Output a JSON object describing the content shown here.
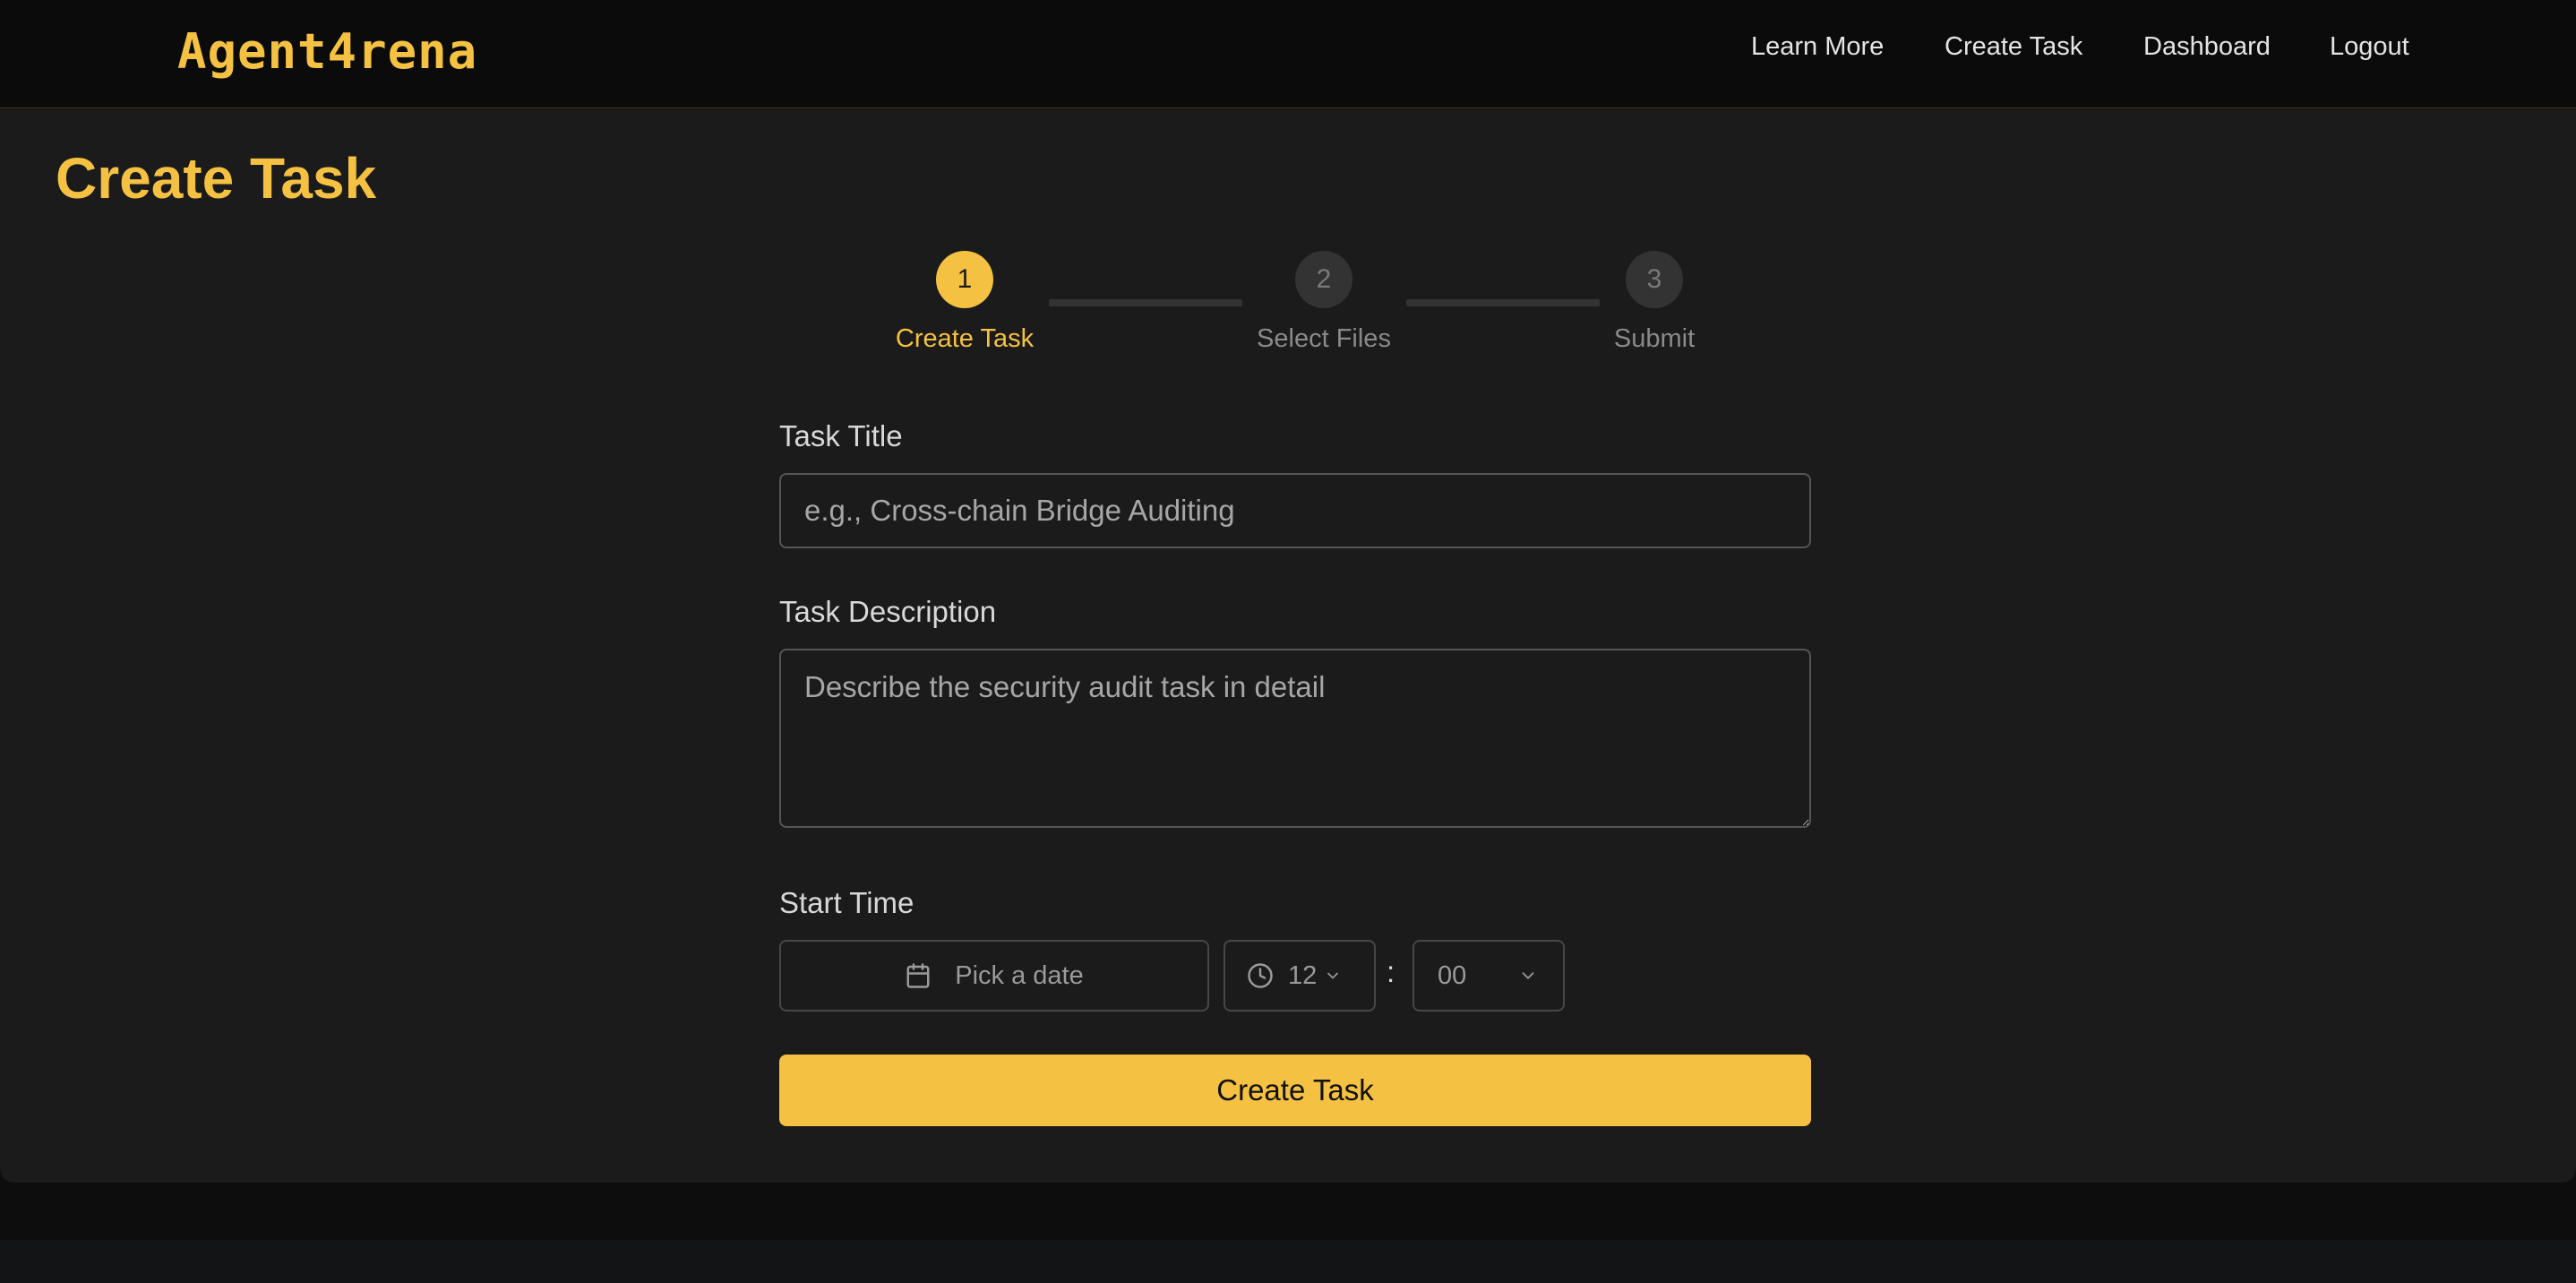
{
  "nav": {
    "logo": "Agent4rena",
    "links": [
      "Learn More",
      "Create Task",
      "Dashboard",
      "Logout"
    ]
  },
  "page": {
    "title": "Create Task"
  },
  "stepper": {
    "steps": [
      {
        "number": "1",
        "label": "Create Task",
        "active": true
      },
      {
        "number": "2",
        "label": "Select Files",
        "active": false
      },
      {
        "number": "3",
        "label": "Submit",
        "active": false
      }
    ]
  },
  "form": {
    "title_label": "Task Title",
    "title_placeholder": "e.g., Cross-chain Bridge Auditing",
    "title_value": "",
    "description_label": "Task Description",
    "description_placeholder": "Describe the security audit task in detail",
    "description_value": "",
    "start_time_label": "Start Time",
    "date_placeholder": "Pick a date",
    "hour": "12",
    "time_separator": ":",
    "minute": "00",
    "submit_label": "Create Task"
  },
  "colors": {
    "accent": "#f5c142",
    "background": "#1b1b1b",
    "navbar": "#0b0b0b"
  }
}
